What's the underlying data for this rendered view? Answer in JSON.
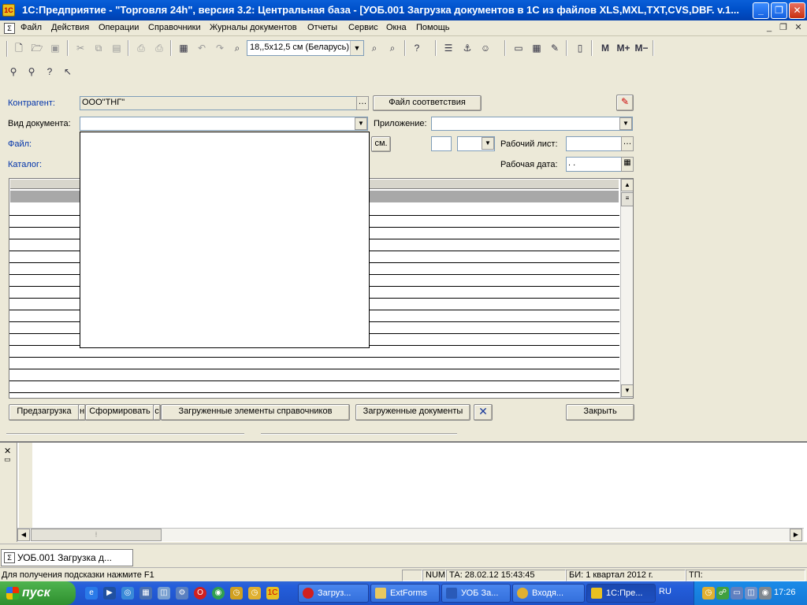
{
  "window": {
    "title": "1С:Предприятие - \"Торговля 24h\", версия 3.2: Центральная база - [УОБ.001 Загрузка документов в 1С из файлов XLS,MXL,TXT,CVS,DBF. v.1...",
    "min": "_",
    "max": "❐",
    "close": "✕"
  },
  "menu": {
    "items": [
      "Файл",
      "Действия",
      "Операции",
      "Справочники",
      "Журналы документов",
      "Отчеты",
      "Сервис",
      "Окна",
      "Помощь"
    ]
  },
  "toolbar": {
    "paper_size": "18,,5x12,5 см (Беларусь)",
    "memory": [
      "M",
      "M+",
      "M−"
    ]
  },
  "form": {
    "counterparty_label": "Контрагент:",
    "counterparty_value": "ООО\"ТНГ\"",
    "mapping_file_button": "Файл соответствия",
    "doc_type_label": "Вид документа:",
    "doc_type_value": "",
    "application_label": "Приложение:",
    "application_value": "",
    "file_label": "Файл:",
    "see_button": "см.",
    "worksheet_label": "Рабочий лист:",
    "worksheet_value": "",
    "catalog_label": "Каталог:",
    "work_date_label": "Рабочая дата:",
    "work_date_value": " .  ."
  },
  "buttons": {
    "preload": "Предзагрузка",
    "form": "Сформировать",
    "loaded_refs": "Загруженные элементы справочников",
    "loaded_docs": "Загруженные документы",
    "close": "Закрыть",
    "partial_n": "н",
    "partial_s": "с"
  },
  "wintabs": {
    "active": "УОБ.001 Загрузка д..."
  },
  "status": {
    "hint": "Для получения подсказки нажмите F1",
    "num": "NUM",
    "ta": "ТА: 28.02.12  15:43:45",
    "bi": "БИ: 1 квартал 2012 г.",
    "tp": "ТП:"
  },
  "taskbar": {
    "start": "пуск",
    "tasks": [
      "Загруз...",
      "ExtForms",
      "УОБ За...",
      "Входя...",
      "1С:Пре..."
    ],
    "lang": "RU",
    "clock": "17:26"
  },
  "colors": {
    "title_bar": "#0052cc",
    "taskbar": "#245edb",
    "start_button": "#3c9a3c",
    "link_label": "#0033aa"
  }
}
